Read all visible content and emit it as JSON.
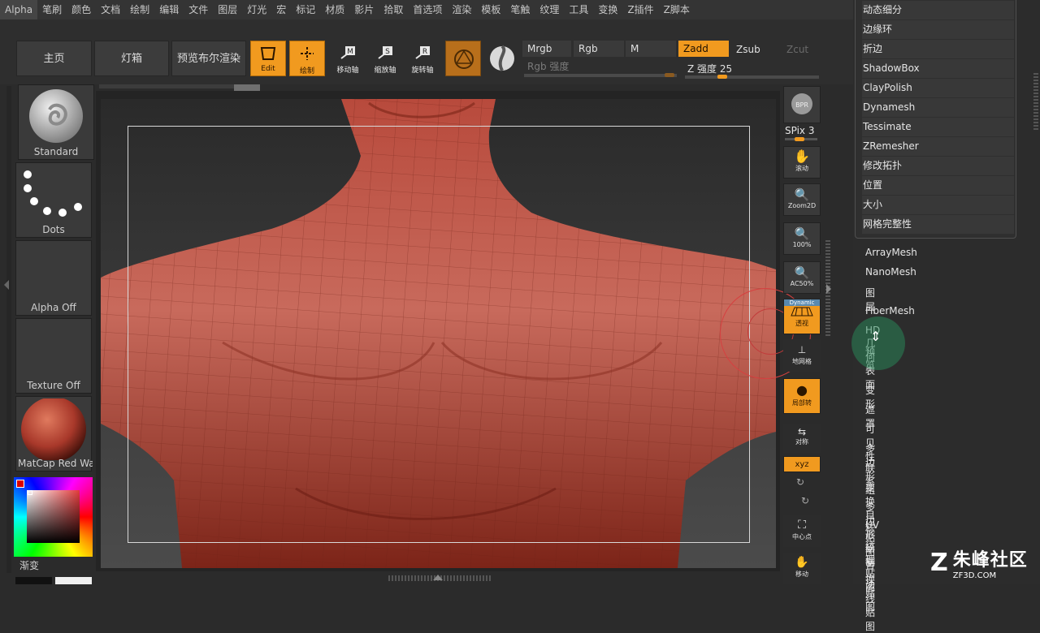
{
  "menubar": {
    "items": [
      "Alpha",
      "笔刷",
      "颜色",
      "文档",
      "绘制",
      "编辑",
      "文件",
      "图层",
      "灯光",
      "宏",
      "标记",
      "材质",
      "影片",
      "拾取",
      "首选项",
      "渲染",
      "模板",
      "笔触",
      "纹理",
      "工具",
      "变换",
      "Z插件",
      "Z脚本"
    ]
  },
  "toolbar": {
    "home": "主页",
    "lightbox": "灯箱",
    "bpr_preview": "预览布尔渲染",
    "edit": "Edit",
    "draw": "绘制",
    "move": "移动轴",
    "scale": "缩放轴",
    "rotate": "旋转轴",
    "mrgb": "Mrgb",
    "rgb": "Rgb",
    "m": "M",
    "zadd": "Zadd",
    "zsub": "Zsub",
    "zcut": "Zcut",
    "rgb_intensity": "Rgb 强度",
    "z_intensity": "Z 强度 25",
    "z_intensity_value": 25
  },
  "left_shelf": {
    "brush": "Standard",
    "stroke": "Dots",
    "alpha": "Alpha Off",
    "texture": "Texture Off",
    "material": "MatCap Red Wax",
    "gradient": "渐变"
  },
  "right_tools": {
    "bpr": "BPR",
    "spix": "SPix 3",
    "scroll": "滚动",
    "zoom2d": "Zoom2D",
    "z100": "100%",
    "ac50": "AC50%",
    "dynamic": "Dynamic",
    "persp": "透视",
    "floor": "地网格",
    "local": "局部转",
    "sym": "对称",
    "xyz": "xyz",
    "center": "中心点",
    "move": "移动"
  },
  "submenu": {
    "items": [
      "动态细分",
      "边缘环",
      "折边",
      "ShadowBox",
      "ClayPolish",
      "Dynamesh",
      "Tessimate",
      "ZRemesher",
      "修改拓扑",
      "位置",
      "大小",
      "网格完整性"
    ]
  },
  "palette": {
    "items": [
      "ArrayMesh",
      "NanoMesh",
      "图层",
      "FiberMesh",
      "HD几何",
      "预览",
      "表面",
      "变形",
      "遮罩",
      "可见性",
      "多边形组",
      "联系",
      "变换目标",
      "多边形绘制",
      "UV 贴图",
      "纹理贴图",
      "置换贴图",
      "法线贴图"
    ]
  },
  "watermark": {
    "brand": "朱峰社区",
    "url": "ZF3D.COM"
  },
  "colors": {
    "accent": "#f19a1f",
    "mesh": "#b5463a"
  }
}
